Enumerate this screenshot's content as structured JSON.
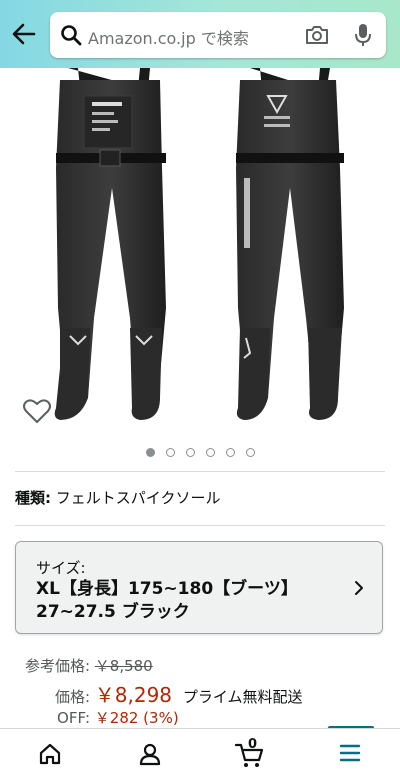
{
  "search": {
    "placeholder": "Amazon.co.jp で検索"
  },
  "product": {
    "carousel_count": 6,
    "active_index": 0
  },
  "variation": {
    "label": "種類:",
    "value": "フェルトスパイクソール"
  },
  "size_selector": {
    "label": "サイズ:",
    "value": "XL【身長】175~180【ブーツ】27~27.5 ブラック"
  },
  "pricing": {
    "list_label": "参考価格:",
    "list_price": "￥8,580",
    "price_label": "価格:",
    "price": "￥8,298",
    "shipping": "プライム無料配送",
    "off_label": "OFF:",
    "off_value": "￥282 (3%)"
  },
  "bottom_nav": {
    "cart_count": "0"
  },
  "colors": {
    "price_red": "#b12704",
    "header_start": "#84d8e3",
    "header_end": "#a8e7c9",
    "accent_teal": "#007185"
  }
}
